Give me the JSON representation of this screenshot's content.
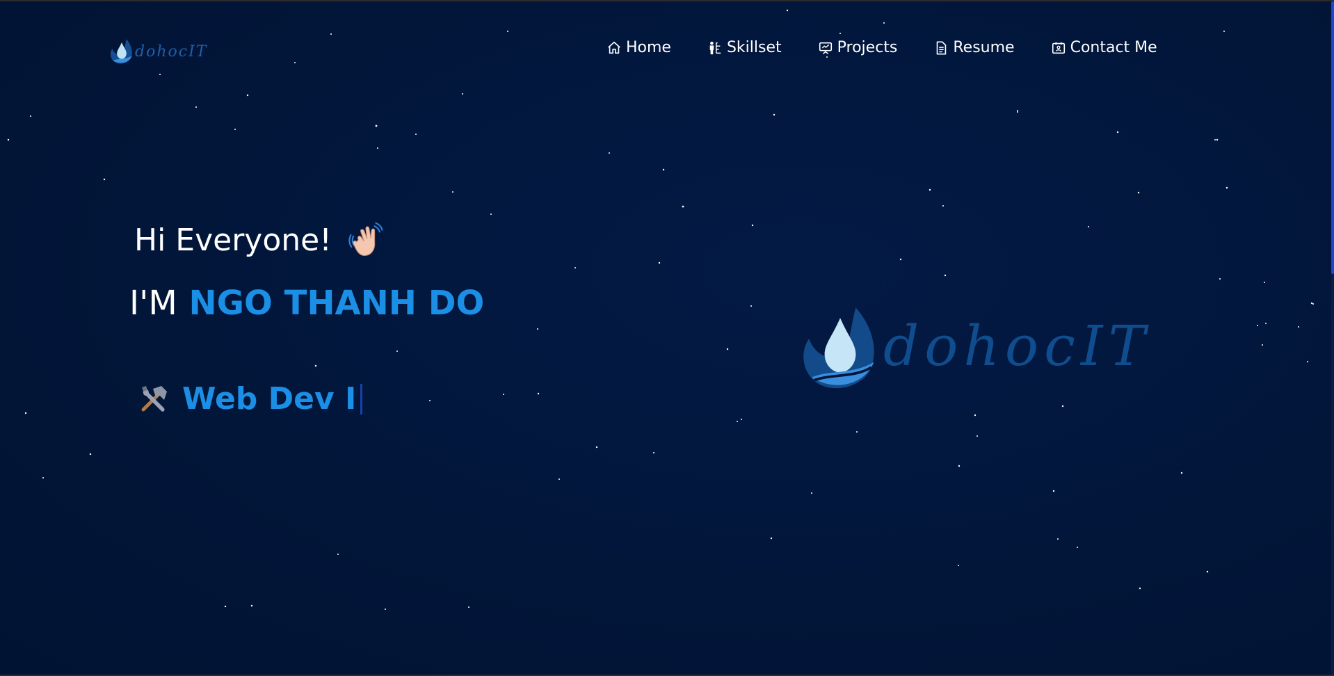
{
  "brand": {
    "logo_text": "dohocIT",
    "hero_logo_text": "dohocIT"
  },
  "nav": {
    "items": [
      {
        "label": "Home",
        "icon": "home-icon"
      },
      {
        "label": "Skillset",
        "icon": "skillset-icon"
      },
      {
        "label": "Projects",
        "icon": "projects-icon"
      },
      {
        "label": "Resume",
        "icon": "resume-icon"
      },
      {
        "label": "Contact Me",
        "icon": "contact-icon"
      }
    ]
  },
  "hero": {
    "greeting": "Hi Everyone!",
    "greeting_emoji": "waving-hand-icon",
    "intro_prefix": "I'M",
    "name": "NGO THANH DO",
    "role_icon": "hammer-wrench-icon",
    "role_text": "Web Dev I"
  },
  "colors": {
    "background": "#02163a",
    "accent": "#1b8fe6",
    "logo_blue": "#0f4d8e",
    "nav_text": "#ffffff",
    "scroll_thumb": "#1b46d6"
  }
}
